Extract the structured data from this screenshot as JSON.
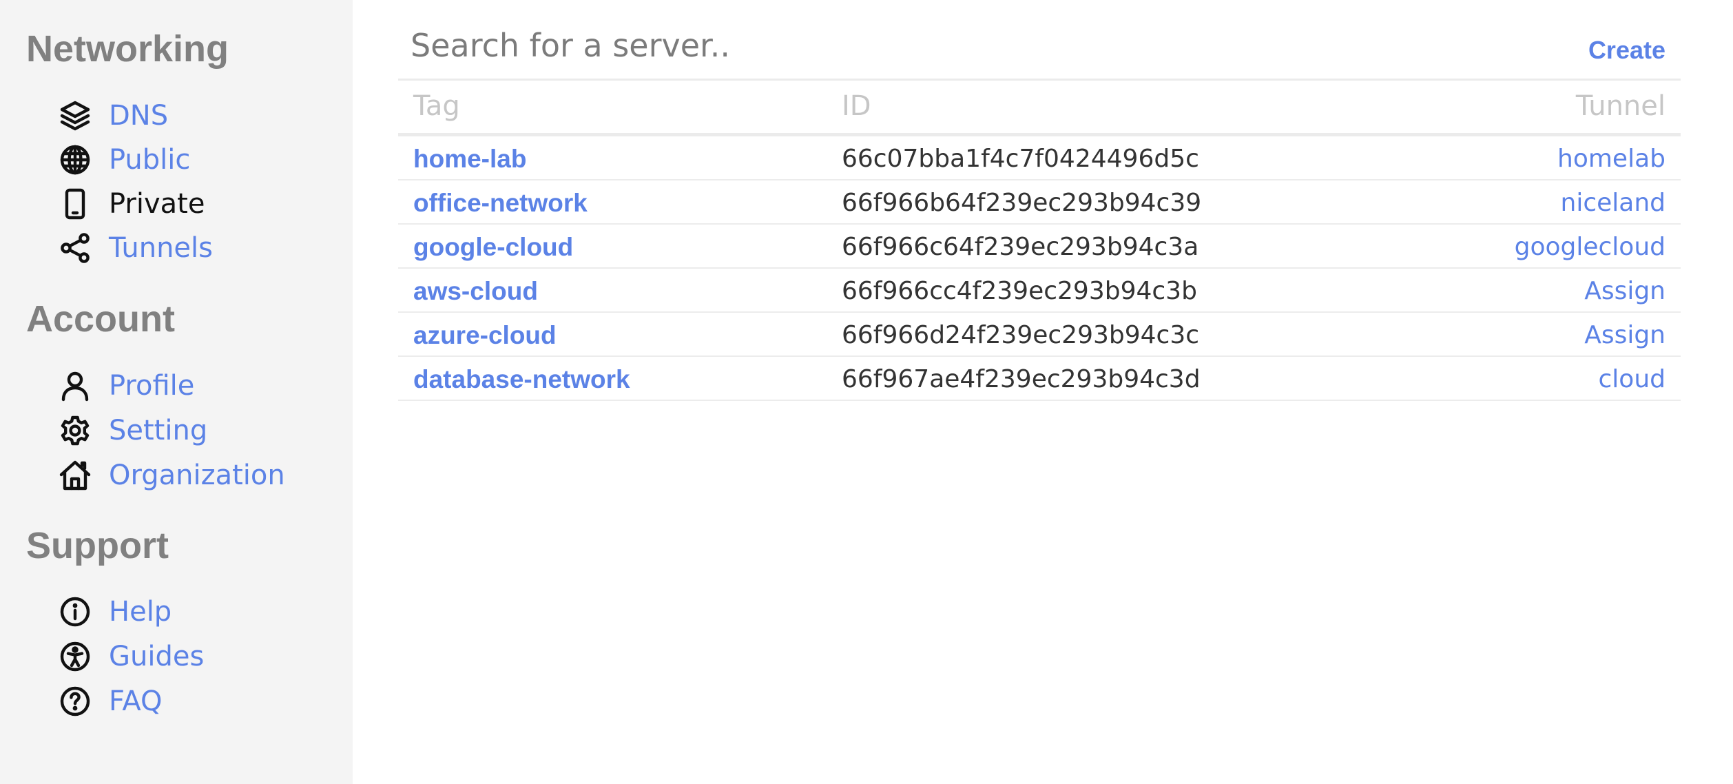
{
  "sidebar": {
    "sections": [
      {
        "title": "Networking",
        "items": [
          {
            "label": "DNS",
            "icon": "layers-icon",
            "active": false
          },
          {
            "label": "Public",
            "icon": "globe-icon",
            "active": false
          },
          {
            "label": "Private",
            "icon": "phone-icon",
            "active": true
          },
          {
            "label": "Tunnels",
            "icon": "share-icon",
            "active": false
          }
        ]
      },
      {
        "title": "Account",
        "items": [
          {
            "label": "Profile",
            "icon": "person-icon",
            "active": false
          },
          {
            "label": "Setting",
            "icon": "gear-icon",
            "active": false
          },
          {
            "label": "Organization",
            "icon": "house-icon",
            "active": false
          }
        ]
      },
      {
        "title": "Support",
        "items": [
          {
            "label": "Help",
            "icon": "info-icon",
            "active": false
          },
          {
            "label": "Guides",
            "icon": "accessibility-icon",
            "active": false
          },
          {
            "label": "FAQ",
            "icon": "question-icon",
            "active": false
          }
        ]
      }
    ]
  },
  "search": {
    "placeholder": "Search for a server..",
    "value": ""
  },
  "toolbar": {
    "create_label": "Create"
  },
  "table": {
    "headers": {
      "tag": "Tag",
      "id": "ID",
      "tunnel": "Tunnel"
    },
    "rows": [
      {
        "tag": "home-lab",
        "id": "66c07bba1f4c7f0424496d5c",
        "tunnel": "homelab"
      },
      {
        "tag": "office-network",
        "id": "66f966b64f239ec293b94c39",
        "tunnel": "niceland"
      },
      {
        "tag": "google-cloud",
        "id": "66f966c64f239ec293b94c3a",
        "tunnel": "googlecloud"
      },
      {
        "tag": "aws-cloud",
        "id": "66f966cc4f239ec293b94c3b",
        "tunnel": "Assign"
      },
      {
        "tag": "azure-cloud",
        "id": "66f966d24f239ec293b94c3c",
        "tunnel": "Assign"
      },
      {
        "tag": "database-network",
        "id": "66f967ae4f239ec293b94c3d",
        "tunnel": "cloud"
      }
    ]
  },
  "colors": {
    "accent": "#5b82e6",
    "sidebar_bg": "#f4f4f4",
    "section_title": "#808080"
  }
}
